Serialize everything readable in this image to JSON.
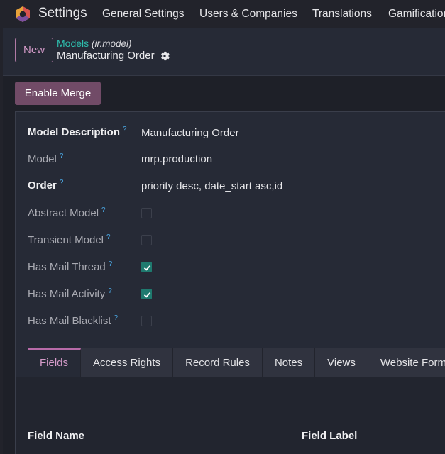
{
  "navbar": {
    "app_name": "Settings",
    "menu": [
      "General Settings",
      "Users & Companies",
      "Translations",
      "Gamification"
    ]
  },
  "control_panel": {
    "new_label": "New",
    "breadcrumb_link": "Models",
    "breadcrumb_model": "(ir.model)",
    "record_title": "Manufacturing Order"
  },
  "actions": {
    "enable_merge": "Enable Merge"
  },
  "form": {
    "help_mark": "?",
    "model_description_label": "Model Description",
    "model_description_value": "Manufacturing Order",
    "model_label": "Model",
    "model_value": "mrp.production",
    "order_label": "Order",
    "order_value": "priority desc, date_start asc,id",
    "abstract_label": "Abstract Model",
    "abstract_checked": false,
    "transient_label": "Transient Model",
    "transient_checked": false,
    "mail_thread_label": "Has Mail Thread",
    "mail_thread_checked": true,
    "mail_activity_label": "Has Mail Activity",
    "mail_activity_checked": true,
    "mail_blacklist_label": "Has Mail Blacklist",
    "mail_blacklist_checked": false
  },
  "tabs": [
    "Fields",
    "Access Rights",
    "Record Rules",
    "Notes",
    "Views",
    "Website Forms"
  ],
  "fields_table": {
    "columns": [
      "Field Name",
      "Field Label"
    ]
  },
  "colors": {
    "accent": "#714b67",
    "link": "#2ebfae",
    "check": "#1f7a6f",
    "help": "#4aa5e0"
  }
}
